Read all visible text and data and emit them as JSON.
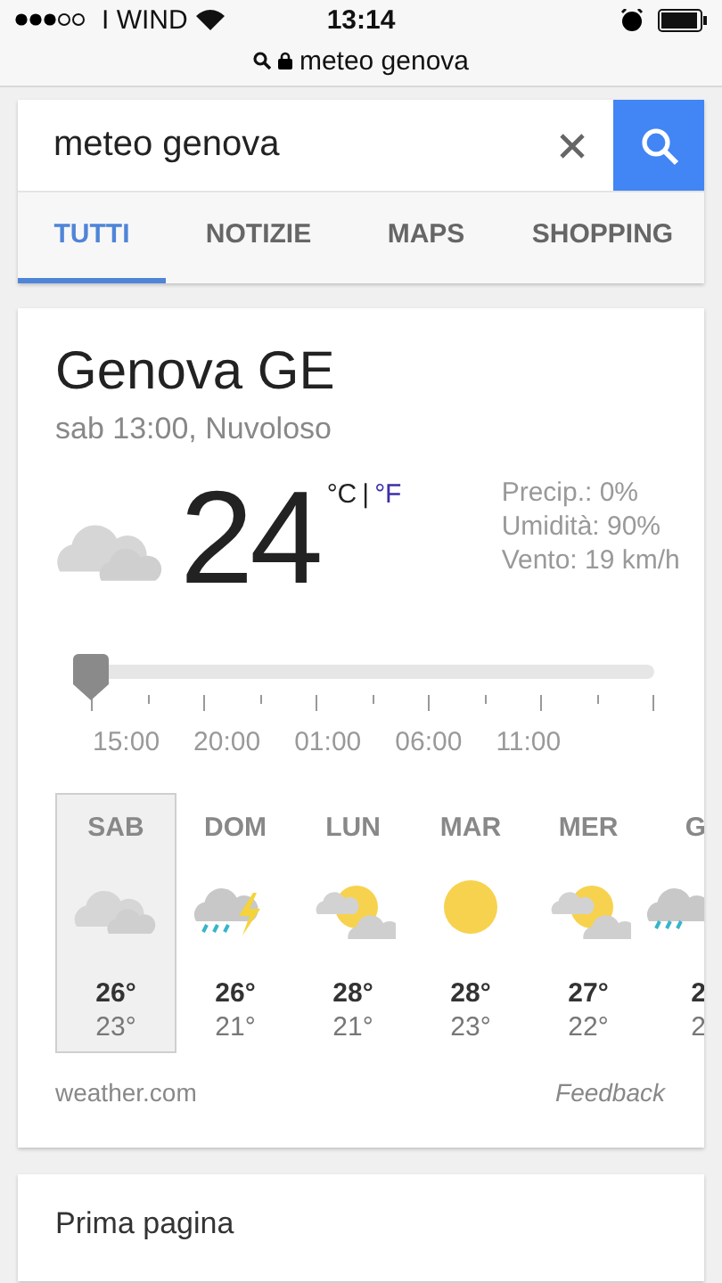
{
  "status_bar": {
    "carrier": "I WIND",
    "time": "13:14"
  },
  "url_bar": {
    "text": "meteo genova"
  },
  "search": {
    "value": "meteo genova"
  },
  "tabs": [
    {
      "label": "TUTTI",
      "selected": true
    },
    {
      "label": "NOTIZIE",
      "selected": false
    },
    {
      "label": "MAPS",
      "selected": false
    },
    {
      "label": "SHOPPING",
      "selected": false
    }
  ],
  "weather": {
    "location": "Genova GE",
    "subtitle": "sab 13:00, Nuvoloso",
    "current": {
      "kind": "cloudy"
    },
    "temperature": "24",
    "units": [
      {
        "label": "°C",
        "selected": true
      },
      {
        "label": "°F",
        "selected": false
      }
    ],
    "unit_separator": "|",
    "details": [
      "Precip.: 0%",
      "Umidità: 90%",
      "Vento: 19 km/h"
    ],
    "timeline": {
      "level": 0,
      "hours": [
        "15:00",
        "20:00",
        "01:00",
        "06:00",
        "11:00"
      ]
    },
    "days": [
      {
        "day": "SAB",
        "kind": "cloudy",
        "high": "26°",
        "low": "23°",
        "selected": true
      },
      {
        "day": "DOM",
        "kind": "thunderstorm",
        "high": "26°",
        "low": "21°",
        "selected": false
      },
      {
        "day": "LUN",
        "kind": "partly-sunny",
        "high": "28°",
        "low": "21°",
        "selected": false
      },
      {
        "day": "MAR",
        "kind": "sunny",
        "high": "28°",
        "low": "23°",
        "selected": false
      },
      {
        "day": "MER",
        "kind": "partly-sunny",
        "high": "27°",
        "low": "22°",
        "selected": false
      },
      {
        "day": "G",
        "kind": "rain",
        "high": "2",
        "low": "2",
        "selected": false
      }
    ],
    "source": "weather.com",
    "feedback": "Feedback"
  },
  "next_card": {
    "title": "Prima pagina"
  }
}
